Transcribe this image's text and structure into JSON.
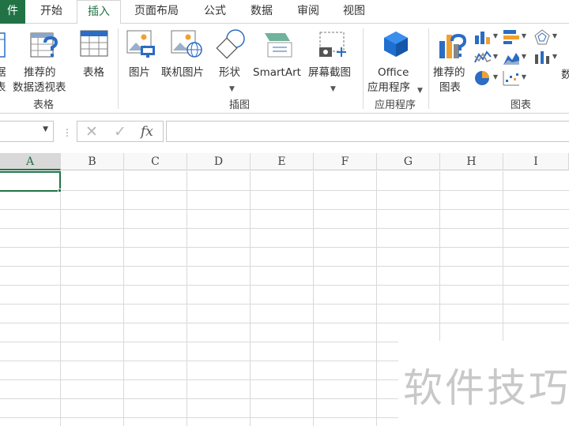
{
  "tabs": {
    "file": "件",
    "home": "开始",
    "insert": "插入",
    "layout": "页面布局",
    "formulas": "公式",
    "data": "数据",
    "review": "审阅",
    "view": "视图"
  },
  "ribbon": {
    "tables_group": {
      "pivot_partial_line1": "据",
      "pivot_partial_line2": "表",
      "recommended_pivot_line1": "推荐的",
      "recommended_pivot_line2": "数据透视表",
      "table": "表格",
      "label": "表格"
    },
    "illustrations_group": {
      "picture": "图片",
      "online_picture": "联机图片",
      "shapes": "形状",
      "smartart": "SmartArt",
      "screenshot": "屏幕截图",
      "label": "插图"
    },
    "apps_group": {
      "office_line1": "Office",
      "office_line2": "应用程序",
      "label": "应用程序"
    },
    "charts_group": {
      "recommended_line1": "推荐的",
      "recommended_line2": "图表",
      "partial": "数",
      "label": "图表"
    },
    "colors": {
      "accent_green": "#217346",
      "icon_blue": "#2b6cc4",
      "icon_orange": "#f0a030"
    }
  },
  "formula_bar": {
    "namebox_value": "",
    "separator": "⋮",
    "cancel_icon": "✕",
    "enter_icon": "✓",
    "fx_label": "fx",
    "formula_value": ""
  },
  "grid": {
    "columns": [
      "A",
      "B",
      "C",
      "D",
      "E",
      "F",
      "G",
      "H",
      "I"
    ],
    "selected_column": "A"
  },
  "watermark": "软件技巧"
}
